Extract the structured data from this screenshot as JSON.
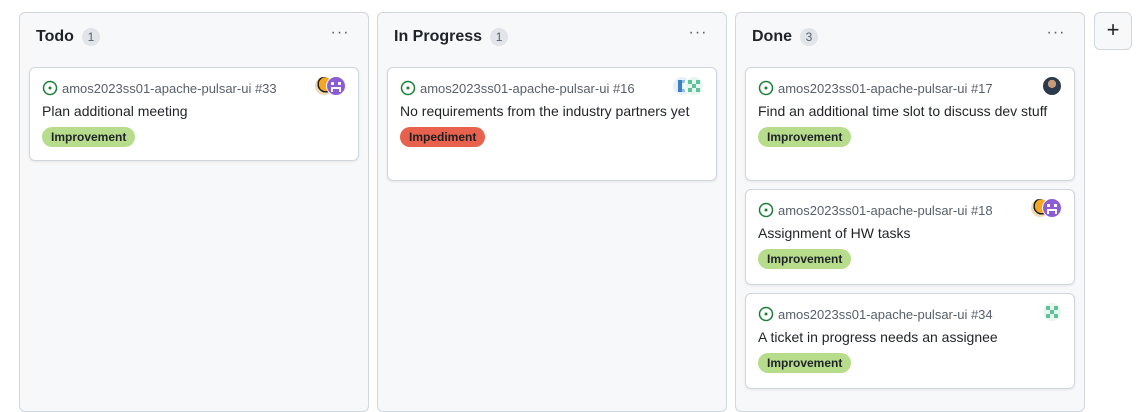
{
  "columns": [
    {
      "title": "Todo",
      "count": "1",
      "cards": [
        {
          "ref": "amos2023ss01-apache-pulsar-ui #33",
          "title": "Plan additional meeting",
          "label": "Improvement",
          "assignees": [
            "avatar-orange",
            "avatar-purple"
          ]
        }
      ]
    },
    {
      "title": "In Progress",
      "count": "1",
      "cards": [
        {
          "ref": "amos2023ss01-apache-pulsar-ui #16",
          "title": "No requirements from the industry partners yet",
          "label": "Impediment",
          "assignees": [
            "avatar-blue",
            "avatar-green"
          ]
        }
      ]
    },
    {
      "title": "Done",
      "count": "3",
      "cards": [
        {
          "ref": "amos2023ss01-apache-pulsar-ui #17",
          "title": "Find an additional time slot to discuss dev stuff",
          "label": "Improvement",
          "assignees": [
            "avatar-photo"
          ]
        },
        {
          "ref": "amos2023ss01-apache-pulsar-ui #18",
          "title": "Assignment of HW tasks",
          "label": "Improvement",
          "assignees": [
            "avatar-orange",
            "avatar-purple"
          ]
        },
        {
          "ref": "amos2023ss01-apache-pulsar-ui #34",
          "title": "A ticket in progress needs an assignee",
          "label": "Improvement",
          "assignees": [
            "avatar-green"
          ]
        }
      ]
    }
  ],
  "more_glyph": "···",
  "add_column_glyph": "+",
  "colors": {
    "open_issue": "#1a7f37",
    "improvement": "#b7dd8c",
    "impediment": "#e8614d"
  },
  "icons": {
    "status": "issue-opened-icon",
    "more": "kebab-horizontal-icon",
    "add": "plus-icon"
  }
}
